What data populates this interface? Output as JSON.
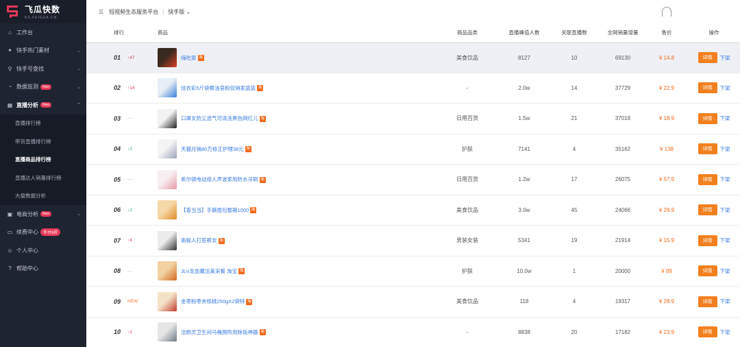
{
  "brand": {
    "title": "飞瓜快数",
    "subtitle": "KS.FEIGUA.CN"
  },
  "sidebar": {
    "items": [
      {
        "label": "工作台",
        "icon": "home-icon",
        "glyph": "⌂",
        "arrow": ""
      },
      {
        "label": "快手热门素材",
        "icon": "fire-icon",
        "glyph": "✦",
        "arrow": "⌄"
      },
      {
        "label": "快手号查找",
        "icon": "search-icon",
        "glyph": "⚲",
        "arrow": "⌄"
      },
      {
        "label": "数据监测",
        "icon": "monitor-icon",
        "glyph": "◔",
        "arrow": "⌄",
        "badge": "New"
      },
      {
        "label": "直播分析",
        "icon": "live-icon",
        "glyph": "▦",
        "arrow": "⌃",
        "badge": "New",
        "open": true
      }
    ],
    "sub_items": [
      "直播排行榜",
      "带货直播排行榜",
      "直播商品排行榜",
      "直播达人销量排行榜",
      "大盘数据分析"
    ],
    "active_sub": 2,
    "items2": [
      {
        "label": "电商分析",
        "icon": "cart-icon",
        "glyph": "▣",
        "arrow": "⌄",
        "badge": "New"
      },
      {
        "label": "续费中心",
        "icon": "card-icon",
        "glyph": "▭",
        "arrow": "",
        "sale": "年付6折"
      },
      {
        "label": "个人中心",
        "icon": "user-icon",
        "glyph": "☺",
        "arrow": ""
      },
      {
        "label": "帮助中心",
        "icon": "help-icon",
        "glyph": "?",
        "arrow": ""
      }
    ]
  },
  "topbar": {
    "platform": "短视频生态服务平台",
    "separator": "|",
    "version": "快手版",
    "caret": "⌄",
    "menu_glyph": "☰"
  },
  "table": {
    "headers": {
      "rank": "排行",
      "goods": "商品",
      "category": "商品品类",
      "peak": "直播峰值人数",
      "related": "关联直播数",
      "sales": "全网销量增量",
      "price": "售价",
      "op": "操作"
    },
    "detail_label": "详情",
    "off_label": "下架",
    "rows": [
      {
        "rank": "01",
        "trend": "↑47",
        "trend_type": "up",
        "name": "嗨吃家",
        "tb": true,
        "category": "美食饮品",
        "peak": "8127",
        "related": "10",
        "sales": "69130",
        "price": "¥ 14.8",
        "thumb": [
          "#3a2a1e",
          "#d8402a"
        ]
      },
      {
        "rank": "02",
        "trend": "↑14",
        "trend_type": "up",
        "name": "炫衣彩5斤袋椰油皂粉促销家庭装",
        "tb": true,
        "category": "-",
        "peak": "2.0w",
        "related": "14",
        "sales": "37729",
        "price": "¥ 22.9",
        "thumb": [
          "#e8eef6",
          "#3b7fd6"
        ]
      },
      {
        "rank": "03",
        "trend": "—",
        "trend_type": "flat",
        "name": "口罩女防尘透气可清洗黑色网红儿",
        "tb": true,
        "category": "日用百货",
        "peak": "1.5w",
        "related": "21",
        "sales": "37018",
        "price": "¥ 18.9",
        "thumb": [
          "#f2f2f2",
          "#222222"
        ]
      },
      {
        "rank": "04",
        "trend": "↓3",
        "trend_type": "down",
        "name": "天猫月销80万修正护理38元",
        "tb": true,
        "category": "护肤",
        "peak": "7141",
        "related": "4",
        "sales": "35162",
        "price": "¥ 138",
        "thumb": [
          "#f4f4f4",
          "#9aa3b8"
        ]
      },
      {
        "rank": "05",
        "trend": "—",
        "trend_type": "flat",
        "name": "希尔顿电动成人声波家用防水牙刷",
        "tb": true,
        "category": "日用百货",
        "peak": "1.2w",
        "related": "17",
        "sales": "26075",
        "price": "¥ 57.9",
        "thumb": [
          "#f6eef0",
          "#e69aa8"
        ]
      },
      {
        "rank": "06",
        "trend": "↓2",
        "trend_type": "down",
        "name": "【香当当】手撕面包整箱1000",
        "tb": true,
        "category": "美食饮品",
        "peak": "3.0w",
        "related": "45",
        "sales": "24066",
        "price": "¥ 29.9",
        "thumb": [
          "#f6d9a8",
          "#e08a2a"
        ]
      },
      {
        "rank": "07",
        "trend": "↑4",
        "trend_type": "up",
        "name": "南极人打底裤女",
        "tb": true,
        "category": "男装女装",
        "peak": "5341",
        "related": "19",
        "sales": "21914",
        "price": "¥ 15.9",
        "thumb": [
          "#ececec",
          "#333333"
        ]
      },
      {
        "rank": "08",
        "trend": "—",
        "trend_type": "flat",
        "name": "JLV龙血藏活莱采餐 淘宝",
        "tb": true,
        "category": "护肤",
        "peak": "10.0w",
        "related": "1",
        "sales": "20000",
        "price": "¥ 89",
        "thumb": [
          "#f3d2a2",
          "#d2691e"
        ]
      },
      {
        "rank": "09",
        "trend": "NEW",
        "trend_type": "new",
        "name": "金枣粉枣夹核桃250gX2袋特",
        "tb": true,
        "category": "美食饮品",
        "peak": "118",
        "related": "4",
        "sales": "19317",
        "price": "¥ 28.9",
        "thumb": [
          "#f4e2c8",
          "#c0392b"
        ]
      },
      {
        "rank": "10",
        "trend": "↑2",
        "trend_type": "up",
        "name": "洁厕灵卫生间马桶厕所用除垢神器",
        "tb": true,
        "category": "-",
        "peak": "8838",
        "related": "20",
        "sales": "17182",
        "price": "¥ 23.9",
        "thumb": [
          "#e6e6e6",
          "#6f7b85"
        ]
      }
    ]
  }
}
